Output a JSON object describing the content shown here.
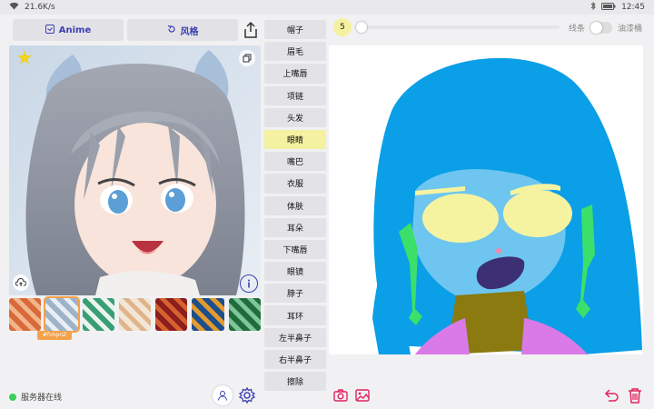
{
  "status": {
    "net_speed": "21.6K/s",
    "time": "12:45"
  },
  "tabs": {
    "anime": "Anime",
    "style": "风格"
  },
  "thumbs": {
    "selected_tag": "#fvnpnZ",
    "colors": [
      [
        "#d86a3a",
        "#f3b48a"
      ],
      [
        "#9fb3c8",
        "#e7eef6"
      ],
      [
        "#3a9e74",
        "#e8f4ec"
      ],
      [
        "#f2e6d7",
        "#e0b48a"
      ],
      [
        "#8c1e1e",
        "#d6622f"
      ],
      [
        "#1d4f8a",
        "#e39a2f"
      ],
      [
        "#1f6d3b",
        "#7fc49a"
      ]
    ]
  },
  "server_status": "服务器在线",
  "parts": [
    "帽子",
    "眉毛",
    "上嘴唇",
    "项链",
    "头发",
    "眼睛",
    "嘴巴",
    "衣服",
    "体肤",
    "耳朵",
    "下嘴唇",
    "眼镜",
    "脖子",
    "耳环",
    "左半鼻子",
    "右半鼻子",
    "擦除"
  ],
  "active_part": "眼睛",
  "brush_size": "5",
  "toggle": {
    "left_label": "线条",
    "right_label": "油漆桶"
  },
  "colors": {
    "accent": "#e0245e",
    "hair": "#0a9fe6",
    "skin": "#6ec6f0",
    "eyes": "#f6f3a0",
    "neck": "#8a7a10",
    "clothes": "#d97ae8",
    "earrings": "#3be06a"
  }
}
